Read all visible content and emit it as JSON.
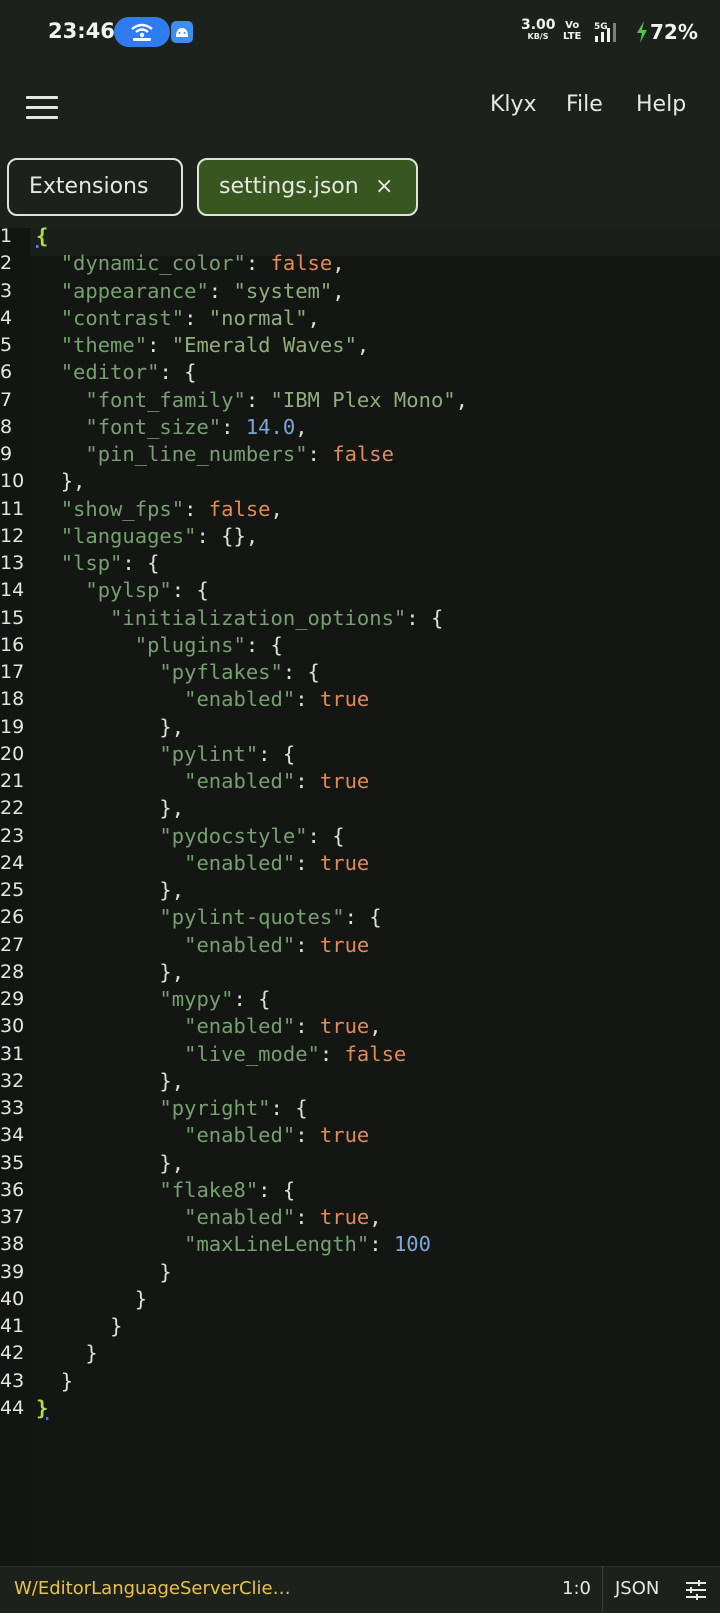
{
  "status_bar": {
    "time": "23:46",
    "net_speed": "3.00",
    "net_speed_unit": "KB/S",
    "volte_top": "Vo",
    "volte_bottom": "LTE",
    "network": "5G",
    "battery": "72%",
    "icons": [
      "hotspot-icon",
      "android-icon",
      "signal-icon",
      "charging-bolt-icon"
    ]
  },
  "app_bar": {
    "menu_icon": "hamburger-menu-icon",
    "menu_items": [
      "Klyx",
      "File",
      "Help"
    ]
  },
  "tabs": [
    {
      "label": "Extensions",
      "active": false
    },
    {
      "label": "settings.json",
      "active": true,
      "close_symbol": "×"
    }
  ],
  "editor": {
    "active_line": 1,
    "lines": [
      {
        "n": "1"
      },
      {
        "n": "2"
      },
      {
        "n": "3"
      },
      {
        "n": "4"
      },
      {
        "n": "5"
      },
      {
        "n": "6"
      },
      {
        "n": "7"
      },
      {
        "n": "8"
      },
      {
        "n": "9"
      },
      {
        "n": "10"
      },
      {
        "n": "11"
      },
      {
        "n": "12"
      },
      {
        "n": "13"
      },
      {
        "n": "14"
      },
      {
        "n": "15"
      },
      {
        "n": "16"
      },
      {
        "n": "17"
      },
      {
        "n": "18"
      },
      {
        "n": "19"
      },
      {
        "n": "20"
      },
      {
        "n": "21"
      },
      {
        "n": "22"
      },
      {
        "n": "23"
      },
      {
        "n": "24"
      },
      {
        "n": "25"
      },
      {
        "n": "26"
      },
      {
        "n": "27"
      },
      {
        "n": "28"
      },
      {
        "n": "29"
      },
      {
        "n": "30"
      },
      {
        "n": "31"
      },
      {
        "n": "32"
      },
      {
        "n": "33"
      },
      {
        "n": "34"
      },
      {
        "n": "35"
      },
      {
        "n": "36"
      },
      {
        "n": "37"
      },
      {
        "n": "38"
      },
      {
        "n": "39"
      },
      {
        "n": "40"
      },
      {
        "n": "41"
      },
      {
        "n": "42"
      },
      {
        "n": "43"
      },
      {
        "n": "44"
      }
    ],
    "code": [
      [
        [
          "brace-hl",
          "{"
        ]
      ],
      [
        [
          "ws",
          "  "
        ],
        [
          "key",
          "\"dynamic_color\""
        ],
        [
          "punc",
          ": "
        ],
        [
          "bool",
          "false"
        ],
        [
          "punc",
          ","
        ]
      ],
      [
        [
          "ws",
          "  "
        ],
        [
          "key",
          "\"appearance\""
        ],
        [
          "punc",
          ": "
        ],
        [
          "str",
          "\"system\""
        ],
        [
          "punc",
          ","
        ]
      ],
      [
        [
          "ws",
          "  "
        ],
        [
          "key",
          "\"contrast\""
        ],
        [
          "punc",
          ": "
        ],
        [
          "str",
          "\"normal\""
        ],
        [
          "punc",
          ","
        ]
      ],
      [
        [
          "ws",
          "  "
        ],
        [
          "key",
          "\"theme\""
        ],
        [
          "punc",
          ": "
        ],
        [
          "str",
          "\"Emerald Waves\""
        ],
        [
          "punc",
          ","
        ]
      ],
      [
        [
          "ws",
          "  "
        ],
        [
          "key",
          "\"editor\""
        ],
        [
          "punc",
          ": "
        ],
        [
          "brace",
          "{"
        ]
      ],
      [
        [
          "ws",
          "    "
        ],
        [
          "key",
          "\"font_family\""
        ],
        [
          "punc",
          ": "
        ],
        [
          "str",
          "\"IBM Plex Mono\""
        ],
        [
          "punc",
          ","
        ]
      ],
      [
        [
          "ws",
          "    "
        ],
        [
          "key",
          "\"font_size\""
        ],
        [
          "punc",
          ": "
        ],
        [
          "num",
          "14.0"
        ],
        [
          "punc",
          ","
        ]
      ],
      [
        [
          "ws",
          "    "
        ],
        [
          "key",
          "\"pin_line_numbers\""
        ],
        [
          "punc",
          ": "
        ],
        [
          "bool",
          "false"
        ]
      ],
      [
        [
          "ws",
          "  "
        ],
        [
          "brace",
          "}"
        ],
        [
          "punc",
          ","
        ]
      ],
      [
        [
          "ws",
          "  "
        ],
        [
          "key",
          "\"show_fps\""
        ],
        [
          "punc",
          ": "
        ],
        [
          "bool",
          "false"
        ],
        [
          "punc",
          ","
        ]
      ],
      [
        [
          "ws",
          "  "
        ],
        [
          "key",
          "\"languages\""
        ],
        [
          "punc",
          ": "
        ],
        [
          "brace",
          "{}"
        ],
        [
          "punc",
          ","
        ]
      ],
      [
        [
          "ws",
          "  "
        ],
        [
          "key",
          "\"lsp\""
        ],
        [
          "punc",
          ": "
        ],
        [
          "brace",
          "{"
        ]
      ],
      [
        [
          "ws",
          "    "
        ],
        [
          "key",
          "\"pylsp\""
        ],
        [
          "punc",
          ": "
        ],
        [
          "brace",
          "{"
        ]
      ],
      [
        [
          "ws",
          "      "
        ],
        [
          "key",
          "\"initialization_options\""
        ],
        [
          "punc",
          ": "
        ],
        [
          "brace",
          "{"
        ]
      ],
      [
        [
          "ws",
          "        "
        ],
        [
          "key",
          "\"plugins\""
        ],
        [
          "punc",
          ": "
        ],
        [
          "brace",
          "{"
        ]
      ],
      [
        [
          "ws",
          "          "
        ],
        [
          "key",
          "\"pyflakes\""
        ],
        [
          "punc",
          ": "
        ],
        [
          "brace",
          "{"
        ]
      ],
      [
        [
          "ws",
          "            "
        ],
        [
          "key",
          "\"enabled\""
        ],
        [
          "punc",
          ": "
        ],
        [
          "bool",
          "true"
        ]
      ],
      [
        [
          "ws",
          "          "
        ],
        [
          "brace",
          "}"
        ],
        [
          "punc",
          ","
        ]
      ],
      [
        [
          "ws",
          "          "
        ],
        [
          "key",
          "\"pylint\""
        ],
        [
          "punc",
          ": "
        ],
        [
          "brace",
          "{"
        ]
      ],
      [
        [
          "ws",
          "            "
        ],
        [
          "key",
          "\"enabled\""
        ],
        [
          "punc",
          ": "
        ],
        [
          "bool",
          "true"
        ]
      ],
      [
        [
          "ws",
          "          "
        ],
        [
          "brace",
          "}"
        ],
        [
          "punc",
          ","
        ]
      ],
      [
        [
          "ws",
          "          "
        ],
        [
          "key",
          "\"pydocstyle\""
        ],
        [
          "punc",
          ": "
        ],
        [
          "brace",
          "{"
        ]
      ],
      [
        [
          "ws",
          "            "
        ],
        [
          "key",
          "\"enabled\""
        ],
        [
          "punc",
          ": "
        ],
        [
          "bool",
          "true"
        ]
      ],
      [
        [
          "ws",
          "          "
        ],
        [
          "brace",
          "}"
        ],
        [
          "punc",
          ","
        ]
      ],
      [
        [
          "ws",
          "          "
        ],
        [
          "key",
          "\"pylint-quotes\""
        ],
        [
          "punc",
          ": "
        ],
        [
          "brace",
          "{"
        ]
      ],
      [
        [
          "ws",
          "            "
        ],
        [
          "key",
          "\"enabled\""
        ],
        [
          "punc",
          ": "
        ],
        [
          "bool",
          "true"
        ]
      ],
      [
        [
          "ws",
          "          "
        ],
        [
          "brace",
          "}"
        ],
        [
          "punc",
          ","
        ]
      ],
      [
        [
          "ws",
          "          "
        ],
        [
          "key",
          "\"mypy\""
        ],
        [
          "punc",
          ": "
        ],
        [
          "brace",
          "{"
        ]
      ],
      [
        [
          "ws",
          "            "
        ],
        [
          "key",
          "\"enabled\""
        ],
        [
          "punc",
          ": "
        ],
        [
          "bool",
          "true"
        ],
        [
          "punc",
          ","
        ]
      ],
      [
        [
          "ws",
          "            "
        ],
        [
          "key",
          "\"live_mode\""
        ],
        [
          "punc",
          ": "
        ],
        [
          "bool",
          "false"
        ]
      ],
      [
        [
          "ws",
          "          "
        ],
        [
          "brace",
          "}"
        ],
        [
          "punc",
          ","
        ]
      ],
      [
        [
          "ws",
          "          "
        ],
        [
          "key",
          "\"pyright\""
        ],
        [
          "punc",
          ": "
        ],
        [
          "brace",
          "{"
        ]
      ],
      [
        [
          "ws",
          "            "
        ],
        [
          "key",
          "\"enabled\""
        ],
        [
          "punc",
          ": "
        ],
        [
          "bool",
          "true"
        ]
      ],
      [
        [
          "ws",
          "          "
        ],
        [
          "brace",
          "}"
        ],
        [
          "punc",
          ","
        ]
      ],
      [
        [
          "ws",
          "          "
        ],
        [
          "key",
          "\"flake8\""
        ],
        [
          "punc",
          ": "
        ],
        [
          "brace",
          "{"
        ]
      ],
      [
        [
          "ws",
          "            "
        ],
        [
          "key",
          "\"enabled\""
        ],
        [
          "punc",
          ": "
        ],
        [
          "bool",
          "true"
        ],
        [
          "punc",
          ","
        ]
      ],
      [
        [
          "ws",
          "            "
        ],
        [
          "key",
          "\"maxLineLength\""
        ],
        [
          "punc",
          ": "
        ],
        [
          "num",
          "100"
        ]
      ],
      [
        [
          "ws",
          "          "
        ],
        [
          "brace",
          "}"
        ]
      ],
      [
        [
          "ws",
          "        "
        ],
        [
          "brace",
          "}"
        ]
      ],
      [
        [
          "ws",
          "      "
        ],
        [
          "brace",
          "}"
        ]
      ],
      [
        [
          "ws",
          "    "
        ],
        [
          "brace",
          "}"
        ]
      ],
      [
        [
          "ws",
          "  "
        ],
        [
          "brace",
          "}"
        ]
      ],
      [
        [
          "brace-hl",
          "}"
        ]
      ]
    ]
  },
  "footer": {
    "path": "W/EditorLanguageServerClie…",
    "cursor_position": "1:0",
    "language": "JSON",
    "settings_icon": "tune-icon"
  },
  "colors": {
    "background": "#121511",
    "chrome": "#1c211b",
    "active_tab": "#38561f",
    "key": "#76a070",
    "string": "#8fad7d",
    "boolean": "#e28b57",
    "number": "#7ea7d8",
    "footer_path": "#e8c24a"
  }
}
